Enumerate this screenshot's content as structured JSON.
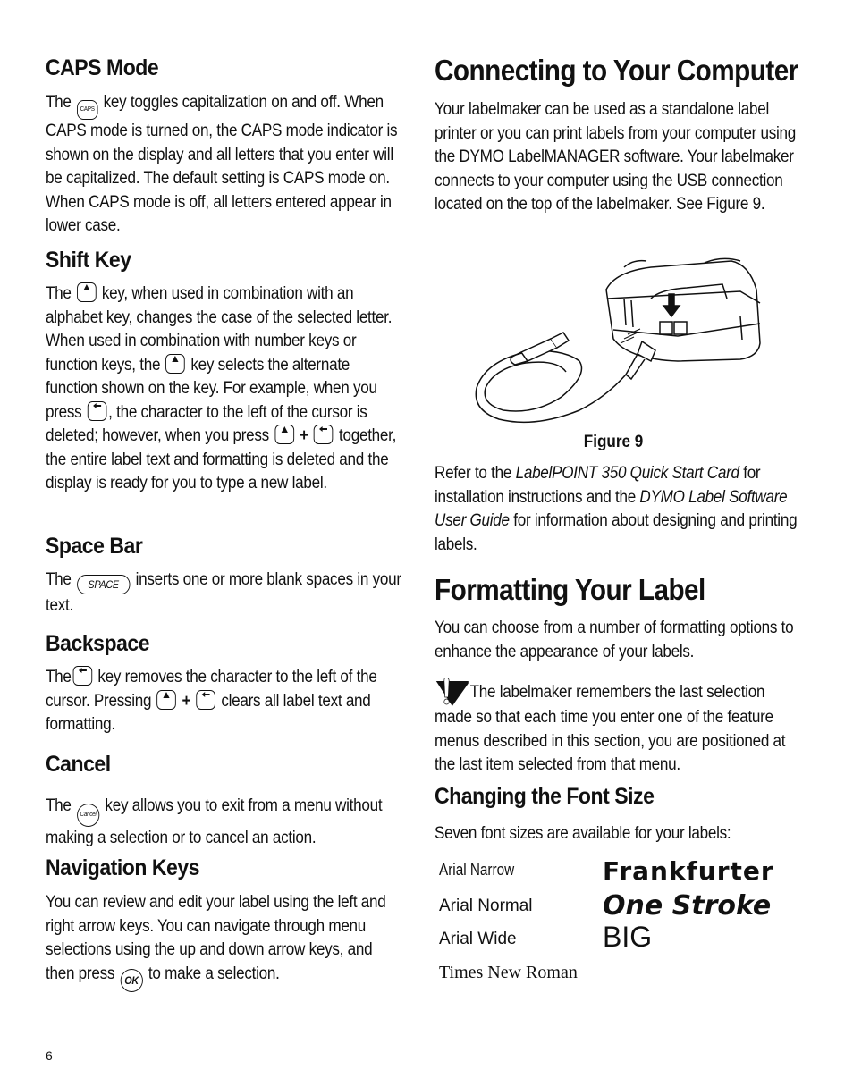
{
  "page_number": "6",
  "left_column": {
    "caps_mode": {
      "heading": "CAPS Mode",
      "text_before_key": "The",
      "key_label": "CAPS",
      "text_after_key": " key toggles capitalization on and off. When CAPS mode is turned on, the CAPS mode indicator is shown on the display and all letters that you enter will be capitalized. The default setting is CAPS mode on. When CAPS mode is off, all letters entered appear in lower case."
    },
    "shift_key": {
      "heading": "Shift Key",
      "t1": "The",
      "t2": " key, when used in combination with an alphabet key, changes the case of the selected letter. When used in combination with number keys or function keys, the",
      "t3": " key selects the alternate function shown on the key. For example, when you press",
      "t4": ", the character to the left of the cursor is deleted; however, when you press",
      "plus": "+",
      "t5": " together, the entire label text and formatting is deleted and the display is ready for you to type a new label."
    },
    "space_bar": {
      "heading": "Space Bar",
      "t1": "The",
      "key_label": "SPACE",
      "t2": " inserts one or more blank spaces in your text."
    },
    "backspace": {
      "heading": "Backspace",
      "t1": "The",
      "t2": " key removes the character to the left of the cursor. Pressing",
      "plus": "+",
      "t3": " clears all label text and formatting."
    },
    "cancel": {
      "heading": "Cancel",
      "t1": "The",
      "key_label": "Cancel",
      "t2": " key allows you to exit from a menu without making a selection or to cancel an action."
    },
    "navigation_keys": {
      "heading": "Navigation Keys",
      "t1": "You can review and edit your label using the left and right arrow keys. You can navigate through menu selections using the up and down arrow keys, and then press",
      "key_label": "OK",
      "t2": " to make a selection."
    }
  },
  "right_column": {
    "connecting": {
      "heading": "Connecting to Your Computer",
      "text": "Your labelmaker can be used as a standalone label printer or you can print labels from your computer using the DYMO LabelMANAGER software. Your labelmaker connects to your computer using the USB connection located on the top of the labelmaker. See Figure 9.",
      "figure_caption": "Figure 9",
      "refer_t1": "Refer to the ",
      "refer_i1": "LabelPOINT 350 Quick Start Card",
      "refer_t2": " for installation instructions and the ",
      "refer_i2": "DYMO Label Software User Guide",
      "refer_t3": " for information about designing and printing labels."
    },
    "formatting": {
      "heading": "Formatting Your Label",
      "text": "You can choose from a number of formatting options to enhance the appearance of your labels.",
      "note": "The labelmaker remembers the last selection made so that each time you enter one of the feature menus described in this section, you are positioned at the last item selected from that menu."
    },
    "font_size": {
      "heading": "Changing the Font Size",
      "text": "Seven font sizes are available for your labels:",
      "fonts": [
        "Arial Narrow",
        "Arial Normal",
        "Arial Wide",
        "Times New Roman",
        "Frankfurter",
        "One Stroke",
        "BIG"
      ]
    }
  }
}
